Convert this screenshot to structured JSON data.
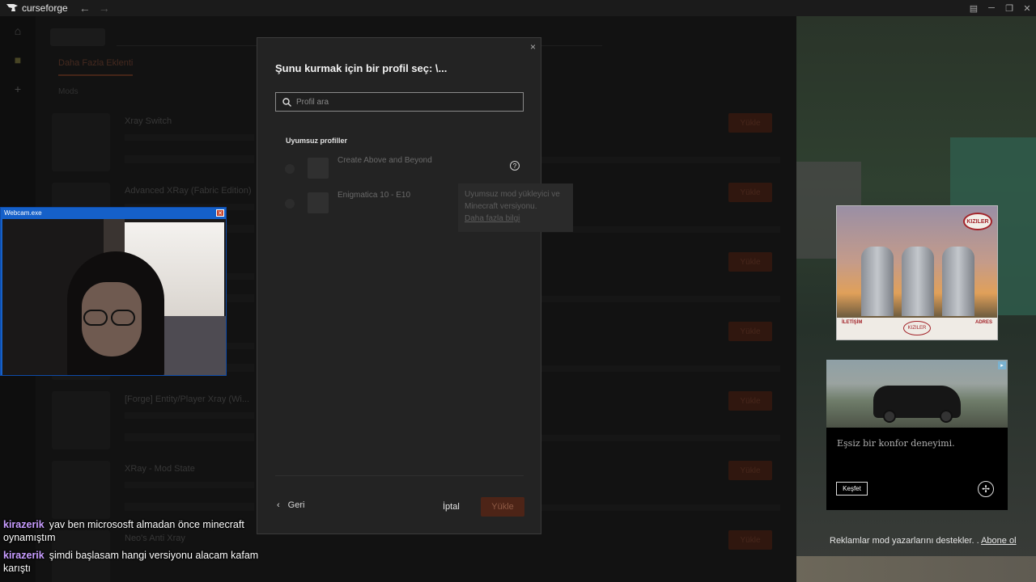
{
  "titlebar": {
    "app_name": "curseforge"
  },
  "background": {
    "tabs": [
      "Daha Fazla Eklenti"
    ],
    "section": "Mods",
    "mods": [
      {
        "title": "Xray Switch",
        "install": "Yükle"
      },
      {
        "title": "Advanced XRay (Fabric Edition)",
        "install": "Yükle"
      },
      {
        "title": "",
        "install": "Yükle"
      },
      {
        "title": "",
        "install": "Yükle"
      },
      {
        "title": "[Forge] Entity/Player Xray (Wi...",
        "install": "Yükle"
      },
      {
        "title": "XRay - Mod State",
        "install": "Yükle"
      },
      {
        "title": "Neo's Anti Xray",
        "install": "Yükle"
      }
    ]
  },
  "modal": {
    "title": "Şunu kurmak için bir profil seç: \\...",
    "search_placeholder": "Profil ara",
    "section_label": "Uyumsuz profiller",
    "profiles": [
      {
        "name": "Create Above and Beyond"
      },
      {
        "name": "Enigmatica 10 - E10"
      }
    ],
    "tooltip": {
      "text_line1": "Uyumsuz mod yükleyici ve",
      "text_line2": "Minecraft versiyonu.",
      "more": "Daha fazla bilgi"
    },
    "back_label": "Geri",
    "cancel_label": "İptal",
    "install_label": "Yükle"
  },
  "webcam": {
    "title": "Webcam.exe"
  },
  "chat": [
    {
      "nick": "kirazerik",
      "text": "yav ben micrososft almadan önce minecraft oynamıştım"
    },
    {
      "nick": "kirazerik",
      "text": "şimdi başlasam hangi versiyonu alacam kafam karıştı"
    }
  ],
  "ads": {
    "ad1": {
      "brand": "KIZILER",
      "left_label": "İLETİŞİM",
      "right_label": "ADRES"
    },
    "ad2": {
      "tagline": "Eşsiz bir konfor deneyimi.",
      "cta": "Keşfet"
    },
    "support_text": "Reklamlar mod yazarlarını destekler. .",
    "support_link": "Abone ol"
  }
}
